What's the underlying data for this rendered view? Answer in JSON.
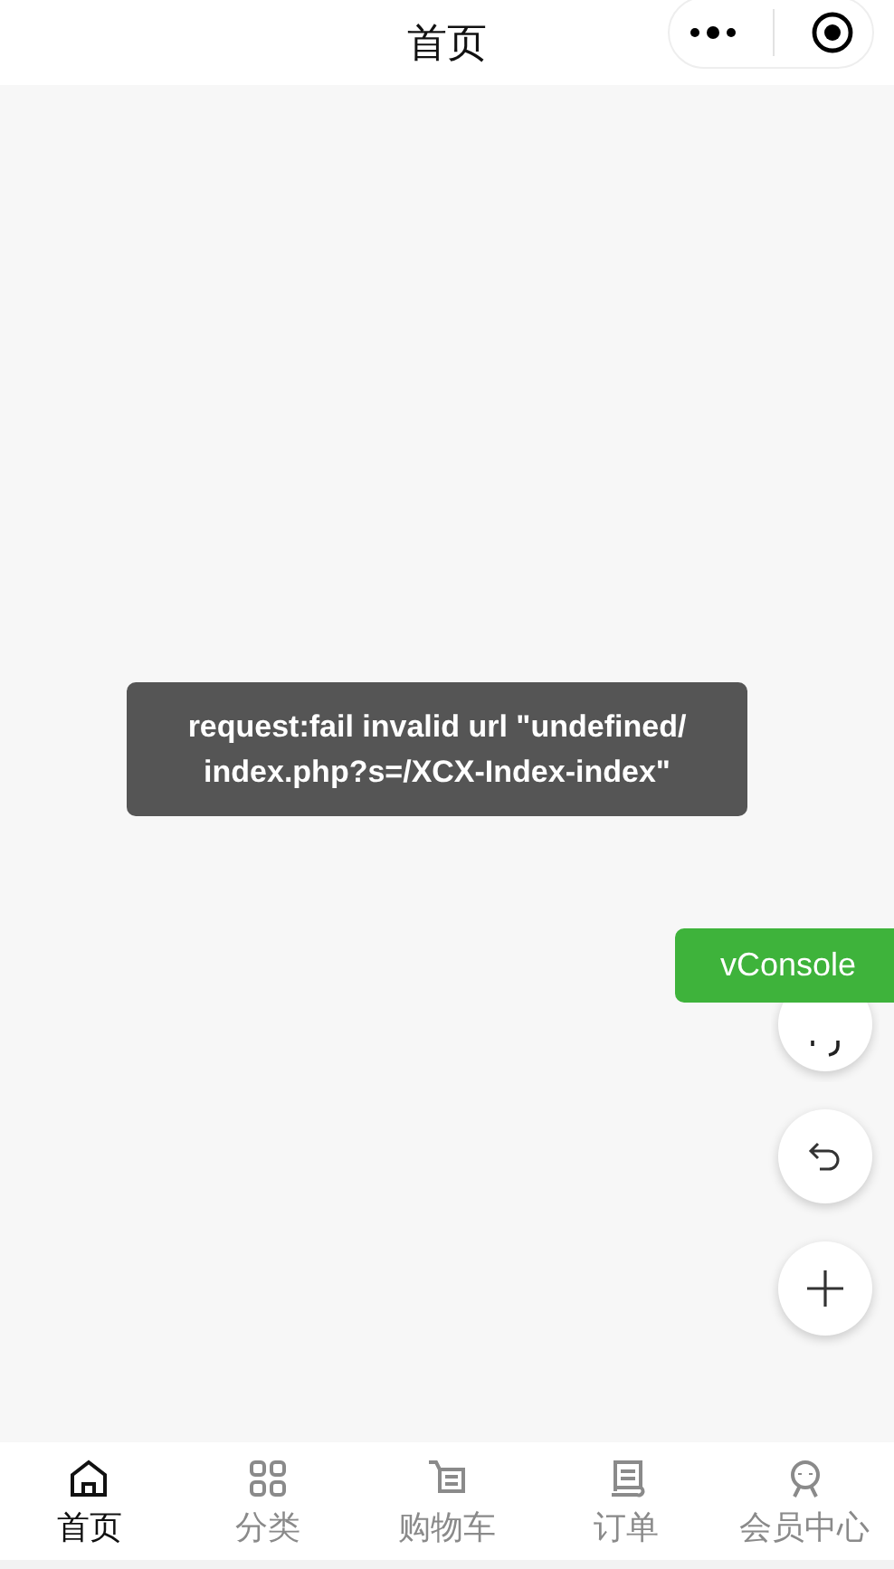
{
  "navbar": {
    "title": "首页"
  },
  "toast": {
    "message": "request:fail invalid url \"undefined/ index.php?s=/XCX-Index-index\""
  },
  "vconsole": {
    "label": "vConsole"
  },
  "tabs": [
    {
      "label": "首页",
      "selected": true
    },
    {
      "label": "分类",
      "selected": false
    },
    {
      "label": "购物车",
      "selected": false
    },
    {
      "label": "订单",
      "selected": false
    },
    {
      "label": "会员中心",
      "selected": false
    }
  ]
}
